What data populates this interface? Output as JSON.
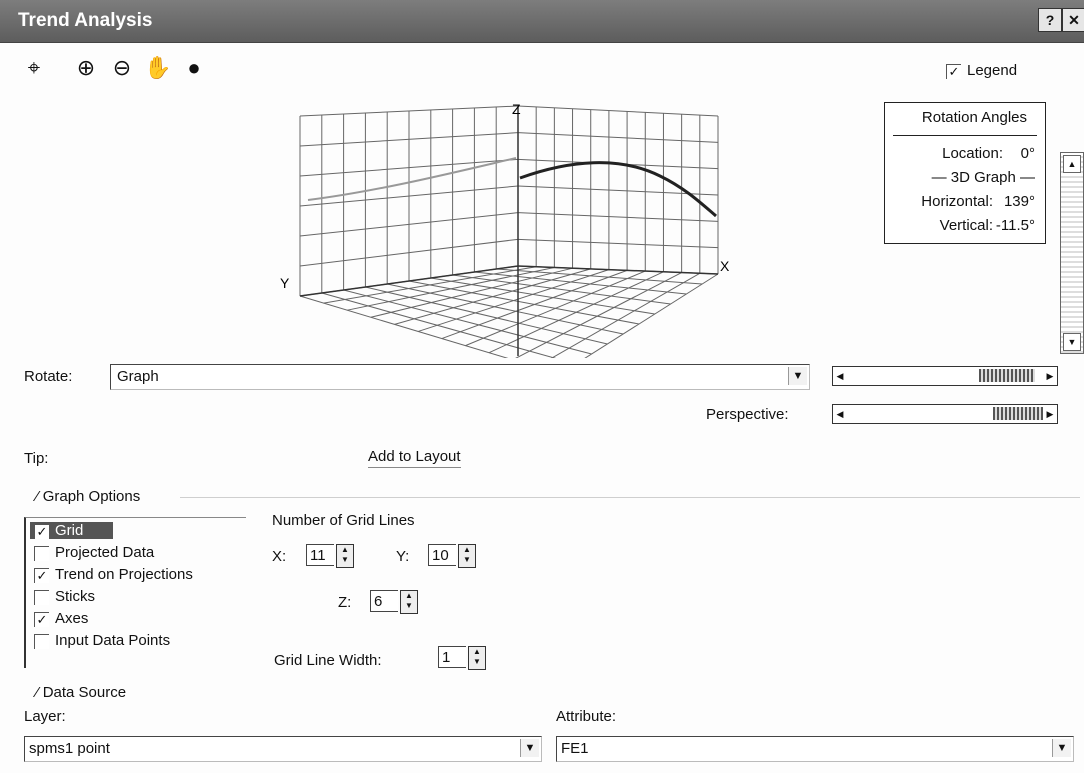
{
  "window": {
    "title": "Trend Analysis",
    "help_btn": "?",
    "close_btn": "✕"
  },
  "toolbar": {
    "tools": [
      {
        "icon": "select-map-icon",
        "glyph": "⌖"
      },
      {
        "icon": "zoom-in-icon",
        "glyph": "⊕"
      },
      {
        "icon": "zoom-out-icon",
        "glyph": "⊖"
      },
      {
        "icon": "pan-hand-icon",
        "glyph": "✋"
      },
      {
        "icon": "full-extent-globe-icon",
        "glyph": "●"
      }
    ]
  },
  "legend": {
    "checked": true,
    "label": "Legend",
    "check_mark": "✓"
  },
  "rotation_angles": {
    "title": "Rotation Angles",
    "location_label": "Location:",
    "location_value": "0°",
    "graph_label": "— 3D Graph —",
    "horizontal_label": "Horizontal:",
    "horizontal_value": "139°",
    "vertical_label": "Vertical:",
    "vertical_value": "-11.5°"
  },
  "graph": {
    "axis_x": "X",
    "axis_y": "Y",
    "axis_z": "Z"
  },
  "rotate": {
    "label": "Rotate:",
    "value": "Graph",
    "arrow": "▼"
  },
  "perspective": {
    "label": "Perspective:"
  },
  "tip": {
    "label": "Tip:",
    "add_to_layout": "Add to Layout"
  },
  "graph_options": {
    "header": "Graph Options",
    "items": [
      {
        "label": "Grid",
        "checked": true,
        "selected": true
      },
      {
        "label": "Projected Data",
        "checked": false,
        "selected": false
      },
      {
        "label": "Trend on Projections",
        "checked": true,
        "selected": false
      },
      {
        "label": "Sticks",
        "checked": false,
        "selected": false
      },
      {
        "label": "Axes",
        "checked": true,
        "selected": false
      },
      {
        "label": "Input Data Points",
        "checked": false,
        "selected": false
      }
    ],
    "grid_lines_title": "Number of Grid Lines",
    "x_label": "X:",
    "x_value": "11",
    "y_label": "Y:",
    "y_value": "10",
    "z_label": "Z:",
    "z_value": "6",
    "line_width_label": "Grid Line Width:",
    "line_width_value": "1"
  },
  "data_source": {
    "header": "Data Source",
    "layer_label": "Layer:",
    "layer_value": "spms1 point",
    "attribute_label": "Attribute:",
    "attribute_value": "FE1",
    "arrow": "▼"
  },
  "colors": {
    "titlebar": "#6a6a6a",
    "selection": "#555555"
  }
}
